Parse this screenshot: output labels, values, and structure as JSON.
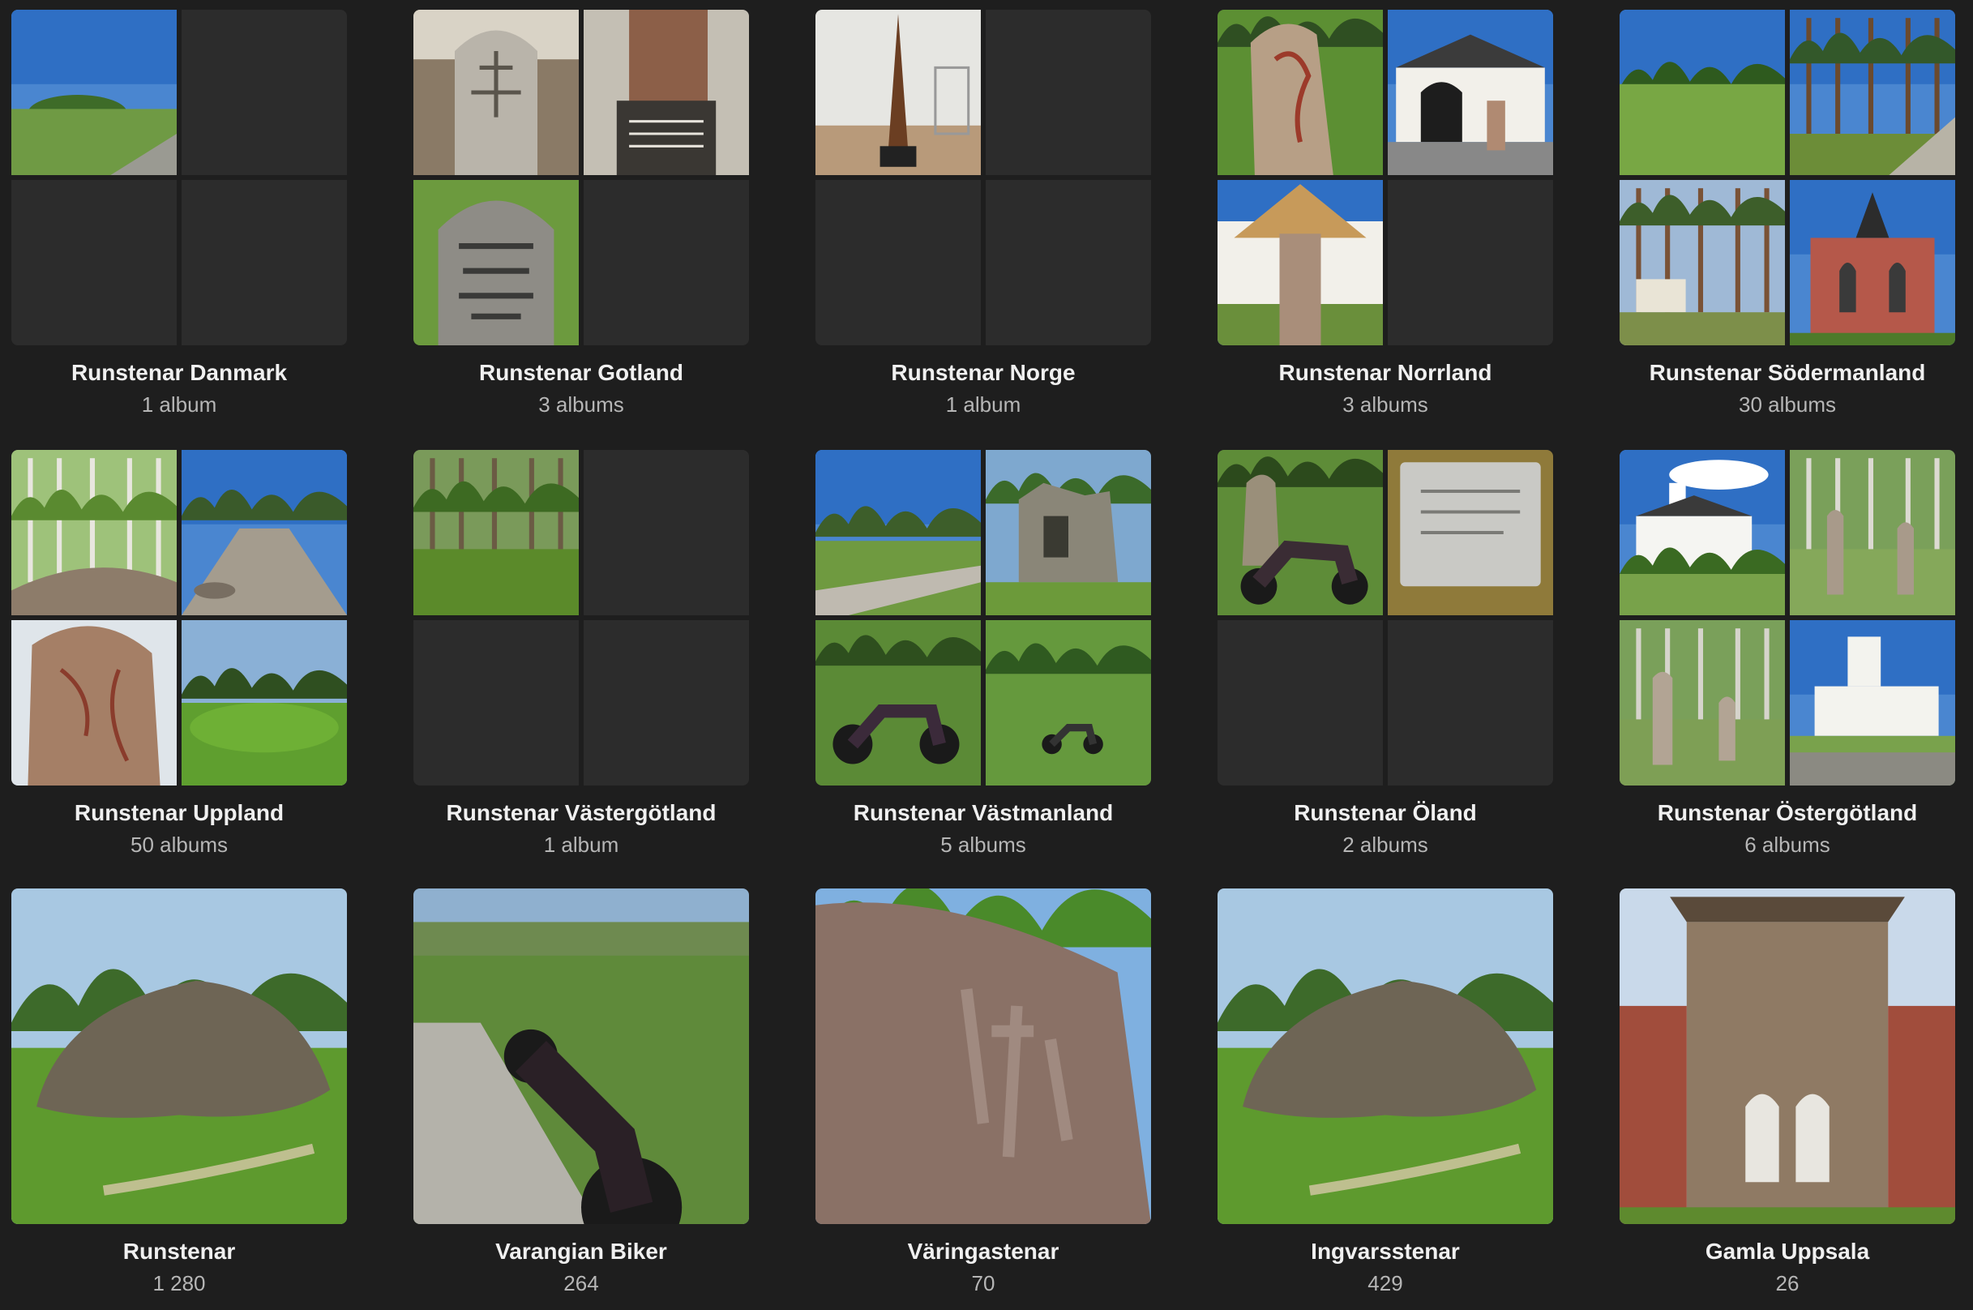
{
  "collections": [
    {
      "title": "Runstenar Danmark",
      "count": "1 album",
      "kind": "folder",
      "tiles": [
        "mound-sky",
        "empty",
        "empty",
        "empty"
      ]
    },
    {
      "title": "Runstenar Gotland",
      "count": "3 albums",
      "kind": "folder",
      "tiles": [
        "picture-stone-museum",
        "stone-display-case",
        "picture-stone-carved",
        "empty"
      ]
    },
    {
      "title": "Runstenar Norge",
      "count": "1 album",
      "kind": "folder",
      "tiles": [
        "museum-obelisk",
        "empty",
        "empty",
        "empty"
      ]
    },
    {
      "title": "Runstenar Norrland",
      "count": "3 albums",
      "kind": "folder",
      "tiles": [
        "runestone-grass",
        "white-church-gate",
        "runestone-shelter",
        "empty"
      ]
    },
    {
      "title": "Runstenar Södermanland",
      "count": "30 albums",
      "kind": "folder",
      "tiles": [
        "meadow-trees",
        "pine-path",
        "pine-forest-church",
        "red-brick-church"
      ]
    },
    {
      "title": "Runstenar Uppland",
      "count": "50 albums",
      "kind": "folder",
      "tiles": [
        "birch-path",
        "gravel-road",
        "runestone-indoor",
        "green-lawn"
      ]
    },
    {
      "title": "Runstenar Västergötland",
      "count": "1 album",
      "kind": "folder",
      "tiles": [
        "forest-undergrowth",
        "empty",
        "empty",
        "empty"
      ]
    },
    {
      "title": "Runstenar Västmanland",
      "count": "5 albums",
      "kind": "folder",
      "tiles": [
        "park-path",
        "stone-ruin",
        "motorcycle-lawn",
        "motorcycle-lawn-far"
      ]
    },
    {
      "title": "Runstenar Öland",
      "count": "2 albums",
      "kind": "folder",
      "tiles": [
        "motorcycle-runestone",
        "metal-plaque",
        "empty",
        "empty"
      ]
    },
    {
      "title": "Runstenar Östergötland",
      "count": "6 albums",
      "kind": "folder",
      "tiles": [
        "white-church-sky",
        "runestones-birch",
        "runestones-birch-2",
        "white-church-wall"
      ]
    },
    {
      "title": "Runstenar",
      "count": "1 280",
      "kind": "album",
      "tiles": [
        "boulder-field"
      ]
    },
    {
      "title": "Varangian Biker",
      "count": "264",
      "kind": "album",
      "tiles": [
        "motorcycle-road"
      ]
    },
    {
      "title": "Väringastenar",
      "count": "70",
      "kind": "album",
      "tiles": [
        "rune-carving-closeup"
      ]
    },
    {
      "title": "Ingvarsstenar",
      "count": "429",
      "kind": "album",
      "tiles": [
        "boulder-field"
      ]
    },
    {
      "title": "Gamla Uppsala",
      "count": "26",
      "kind": "album",
      "tiles": [
        "stone-church-tower"
      ]
    }
  ],
  "colors": {
    "background": "#1e1e1e",
    "tile_empty": "#2c2c2c",
    "title": "#f0f0f0",
    "subtitle": "#b6b6b6"
  }
}
